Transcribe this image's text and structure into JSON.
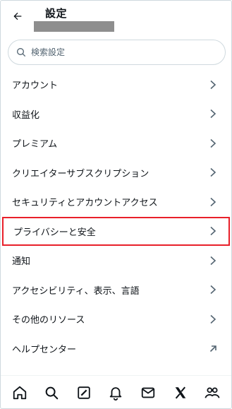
{
  "header": {
    "title": "設定",
    "back_icon": "arrow-left-icon"
  },
  "search": {
    "placeholder": "検索設定",
    "value": ""
  },
  "menu": [
    {
      "label": "アカウント",
      "icon": "chevron-right-icon"
    },
    {
      "label": "収益化",
      "icon": "chevron-right-icon"
    },
    {
      "label": "プレミアム",
      "icon": "chevron-right-icon"
    },
    {
      "label": "クリエイターサブスクリプション",
      "icon": "chevron-right-icon"
    },
    {
      "label": "セキュリティとアカウントアクセス",
      "icon": "chevron-right-icon"
    },
    {
      "label": "プライバシーと安全",
      "icon": "chevron-right-icon",
      "highlighted": true
    },
    {
      "label": "通知",
      "icon": "chevron-right-icon"
    },
    {
      "label": "アクセシビリティ、表示、言語",
      "icon": "chevron-right-icon"
    },
    {
      "label": "その他のリソース",
      "icon": "chevron-right-icon"
    },
    {
      "label": "ヘルプセンター",
      "icon": "external-arrow-icon"
    }
  ],
  "bottom_nav": [
    "home-icon",
    "search-icon",
    "grok-icon",
    "bell-icon",
    "mail-icon",
    "x-logo-icon",
    "communities-icon"
  ],
  "colors": {
    "text": "#0f1419",
    "secondary_text": "#536471",
    "highlight_border": "#e8202a",
    "redaction": "#8e8e8e"
  }
}
